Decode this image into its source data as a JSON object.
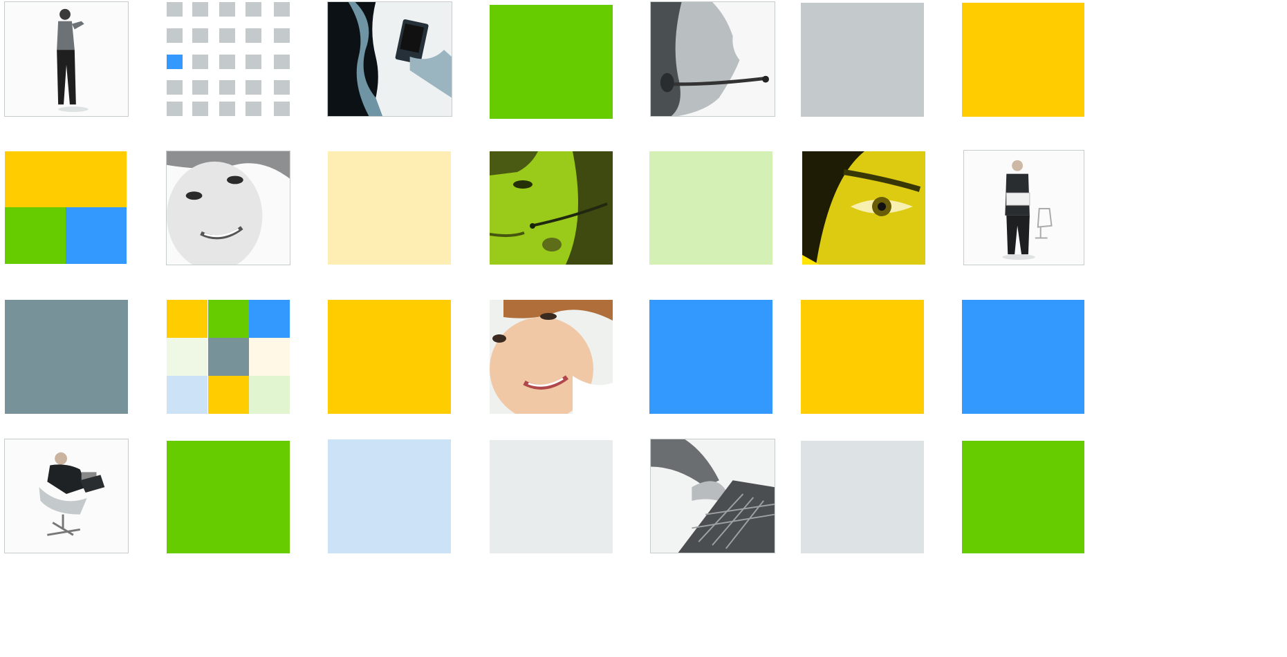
{
  "colors": {
    "green": "#66cc00",
    "yellow": "#ffcc00",
    "blue": "#3399ff",
    "gray_light": "#c4cacb",
    "slate": "#78929a",
    "cream": "#ffeeb4",
    "pale_green": "#d4f0b4",
    "pale_blue": "#cce3f7",
    "pale_gray": "#e9eced",
    "mist": "#dde2e4"
  },
  "dotgrid": {
    "highlight_index": 10
  },
  "tiles": [
    {
      "id": "r1c1",
      "kind": "photo",
      "subject": "woman-standing-pointing"
    },
    {
      "id": "r1c2",
      "kind": "dotgrid"
    },
    {
      "id": "r1c3",
      "kind": "photo",
      "subject": "ear-and-handheld-device"
    },
    {
      "id": "r1c4",
      "kind": "solid",
      "color": "green"
    },
    {
      "id": "r1c5",
      "kind": "photo",
      "subject": "person-with-headset-profile"
    },
    {
      "id": "r1c6",
      "kind": "solid",
      "color": "gray_light"
    },
    {
      "id": "r1c7",
      "kind": "solid",
      "color": "yellow"
    },
    {
      "id": "r2c1",
      "kind": "quad",
      "colors": [
        "yellow",
        "green",
        "blue"
      ]
    },
    {
      "id": "r2c2",
      "kind": "photo",
      "subject": "smiling-woman-closeup"
    },
    {
      "id": "r2c3",
      "kind": "solid",
      "color": "cream"
    },
    {
      "id": "r2c4",
      "kind": "photo",
      "subject": "man-with-headset-green-tint"
    },
    {
      "id": "r2c5",
      "kind": "solid",
      "color": "pale_green"
    },
    {
      "id": "r2c6",
      "kind": "photo",
      "subject": "eye-closeup-yellow-tint"
    },
    {
      "id": "r2c7",
      "kind": "photo",
      "subject": "businessman-holding-laptop"
    },
    {
      "id": "r3c1",
      "kind": "solid",
      "color": "slate"
    },
    {
      "id": "r3c2",
      "kind": "mosaic"
    },
    {
      "id": "r3c3",
      "kind": "solid",
      "color": "yellow"
    },
    {
      "id": "r3c4",
      "kind": "photo",
      "subject": "smiling-woman-color"
    },
    {
      "id": "r3c5",
      "kind": "solid",
      "color": "blue"
    },
    {
      "id": "r3c6",
      "kind": "solid",
      "color": "yellow"
    },
    {
      "id": "r3c7",
      "kind": "solid",
      "color": "blue"
    },
    {
      "id": "r4c1",
      "kind": "photo",
      "subject": "man-in-office-chair-with-laptop"
    },
    {
      "id": "r4c2",
      "kind": "solid",
      "color": "green"
    },
    {
      "id": "r4c3",
      "kind": "solid",
      "color": "pale_blue"
    },
    {
      "id": "r4c4",
      "kind": "solid",
      "color": "pale_gray"
    },
    {
      "id": "r4c5",
      "kind": "photo",
      "subject": "hand-on-keyboard"
    },
    {
      "id": "r4c6",
      "kind": "solid",
      "color": "mist"
    },
    {
      "id": "r4c7",
      "kind": "solid",
      "color": "green"
    }
  ],
  "mosaic_colors": [
    "yellow",
    "green",
    "blue",
    "#eef8e4",
    "slate",
    "#fff8e6",
    "pale_blue",
    "yellow",
    "#e0f5d0"
  ]
}
